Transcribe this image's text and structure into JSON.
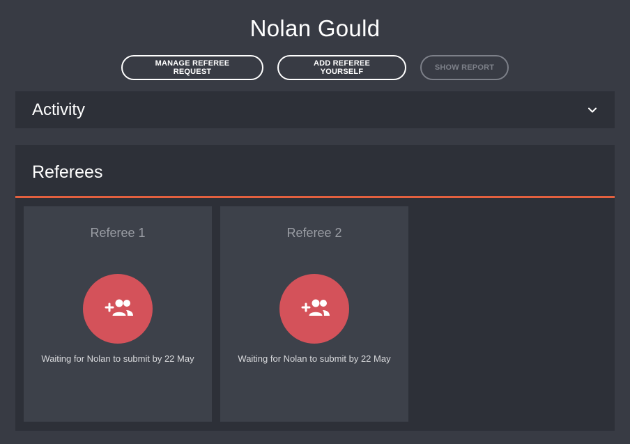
{
  "page": {
    "title": "Nolan Gould"
  },
  "actions": {
    "manage_label": "MANAGE REFEREE REQUEST",
    "add_label": "ADD REFEREE YOURSELF",
    "report_label": "SHOW REPORT"
  },
  "activity": {
    "title": "Activity",
    "icon": "chevron-down-icon"
  },
  "referees": {
    "title": "Referees",
    "accent_color": "#e2603f",
    "cards": [
      {
        "title": "Referee 1",
        "icon": "add-group-icon",
        "status": "Waiting for Nolan to submit by 22 May"
      },
      {
        "title": "Referee 2",
        "icon": "add-group-icon",
        "status": "Waiting for Nolan to submit by 22 May"
      }
    ]
  },
  "colors": {
    "background": "#383b44",
    "panel": "#2d3038",
    "card": "#3d414a",
    "add_button": "#d4525a",
    "disabled": "#7d8089"
  }
}
